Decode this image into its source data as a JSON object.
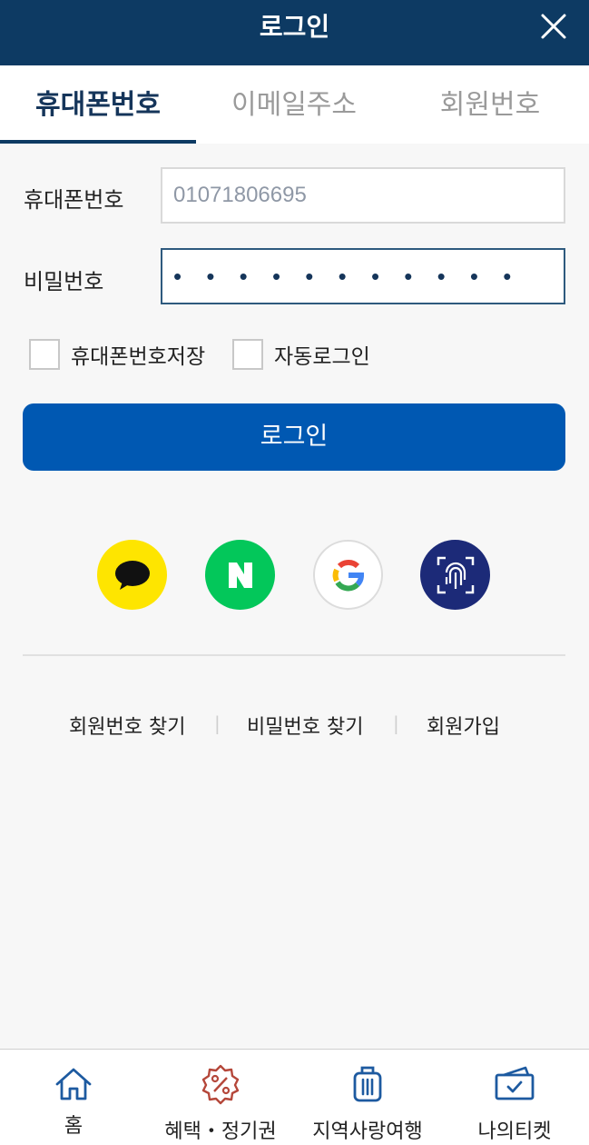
{
  "header": {
    "title": "로그인"
  },
  "tabs": [
    {
      "label": "휴대폰번호"
    },
    {
      "label": "이메일주소"
    },
    {
      "label": "회원번호"
    }
  ],
  "form": {
    "phone_label": "휴대폰번호",
    "phone_value": "01071806695",
    "password_label": "비밀번호",
    "password_value": "• • • • • • • • • • •"
  },
  "options": {
    "save_phone_label": "휴대폰번호저장",
    "auto_login_label": "자동로그인"
  },
  "login_button": {
    "label": "로그인"
  },
  "social_logins": [
    {
      "icon": "kakao-icon",
      "color": "#fee500"
    },
    {
      "icon": "naver-icon",
      "color": "#03c75a"
    },
    {
      "icon": "google-icon",
      "color": "#ffffff"
    },
    {
      "icon": "fingerprint-icon",
      "color": "#1c2a78"
    }
  ],
  "links": {
    "find_member_number": "회원번호 찾기",
    "find_password": "비밀번호 찾기",
    "sign_up": "회원가입",
    "separator": "|"
  },
  "bottom_nav": [
    {
      "label": "홈",
      "icon": "home-icon"
    },
    {
      "label": "혜택・정기권",
      "icon": "discount-badge-icon"
    },
    {
      "label": "지역사랑여행",
      "icon": "suitcase-icon"
    },
    {
      "label": "나의티켓",
      "icon": "ticket-icon"
    }
  ],
  "colors": {
    "header_bg": "#0d3a63",
    "primary_button": "#0058b2",
    "active_tab_text": "#15355a",
    "discount_icon": "#b5473a"
  }
}
